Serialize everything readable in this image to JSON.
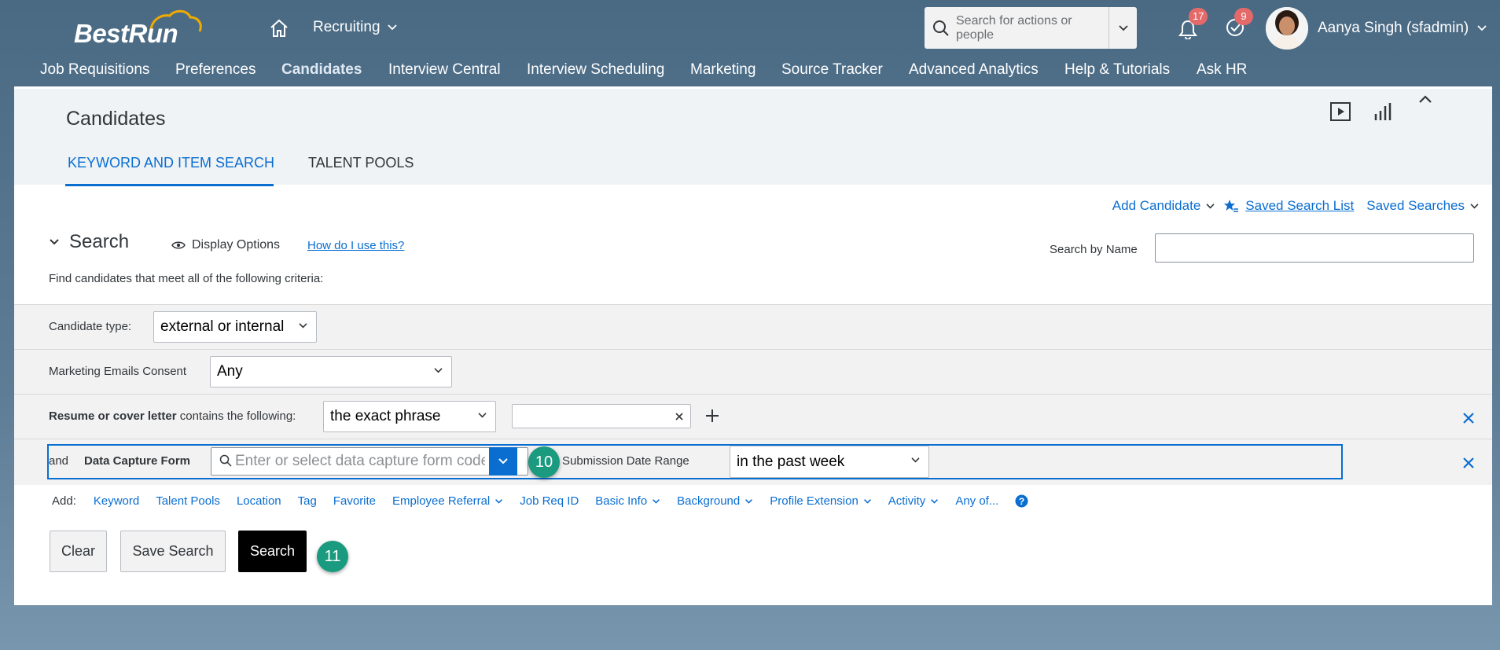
{
  "header": {
    "logo_text": "BestRun",
    "module": "Recruiting",
    "search_placeholder": "Search for actions or people",
    "notifications_count": "17",
    "todo_count": "9",
    "user_name": "Aanya Singh (sfadmin)"
  },
  "topnav": [
    "Job Requisitions",
    "Preferences",
    "Candidates",
    "Interview Central",
    "Interview Scheduling",
    "Marketing",
    "Source Tracker",
    "Advanced Analytics",
    "Help & Tutorials",
    "Ask HR"
  ],
  "page": {
    "title": "Candidates",
    "tabs": [
      "KEYWORD AND ITEM SEARCH",
      "TALENT POOLS"
    ]
  },
  "actions": {
    "add_candidate": "Add Candidate",
    "saved_search_list": "Saved Search List",
    "saved_searches": "Saved Searches"
  },
  "search": {
    "title": "Search",
    "display_options": "Display Options",
    "how_to": "How do I use this?",
    "search_by_name_label": "Search by Name",
    "criteria_text": "Find candidates that meet all of the following criteria:"
  },
  "criteria": {
    "candidate_type_label": "Candidate type:",
    "candidate_type_value": "external or internal",
    "marketing_label": "Marketing Emails Consent",
    "marketing_value": "Any",
    "resume_label_bold": "Resume or cover letter",
    "resume_label_rest": " contains the following:",
    "resume_match": "the exact phrase",
    "dcf_and": "and",
    "dcf_label": "Data Capture Form",
    "dcf_placeholder": "Enter or select data capture form code",
    "submission_label": "Submission Date Range",
    "submission_value": "in the past week"
  },
  "add": {
    "label": "Add:",
    "links": [
      "Keyword",
      "Talent Pools",
      "Location",
      "Tag",
      "Favorite",
      "Employee Referral",
      "Job Req ID",
      "Basic Info",
      "Background",
      "Profile Extension",
      "Activity",
      "Any of..."
    ]
  },
  "buttons": {
    "clear": "Clear",
    "save_search": "Save Search",
    "search": "Search"
  },
  "steps": [
    "10",
    "11"
  ],
  "colors": {
    "accent": "#0a6ed1",
    "step_badge": "#1a9a7e",
    "notification_badge": "#e46a6a"
  }
}
